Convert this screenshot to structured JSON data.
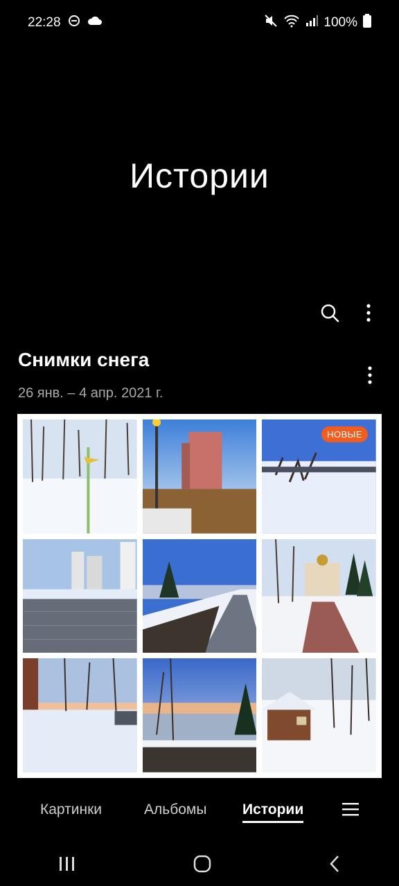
{
  "status_bar": {
    "time": "22:28",
    "battery": "100%",
    "icons": [
      "dnd-icon",
      "cloud-icon",
      "mute-icon",
      "wifi-icon",
      "signal-icon",
      "battery-icon"
    ]
  },
  "header": {
    "title": "Истории"
  },
  "story": {
    "title": "Снимки снега",
    "date_range": "26 янв. – 4 апр. 2021 г.",
    "badge": "НОВЫЕ",
    "photos": [
      "snow-park",
      "sunset-building",
      "frozen-pond",
      "paved-path-towers",
      "riverside-path",
      "church-walkway",
      "brick-wall-snow",
      "birch-river",
      "snowy-cabin"
    ]
  },
  "tabs": [
    {
      "label": "Картинки"
    },
    {
      "label": "Альбомы"
    },
    {
      "label": "Истории",
      "active": true
    }
  ],
  "accent_color": "#f25c1f"
}
